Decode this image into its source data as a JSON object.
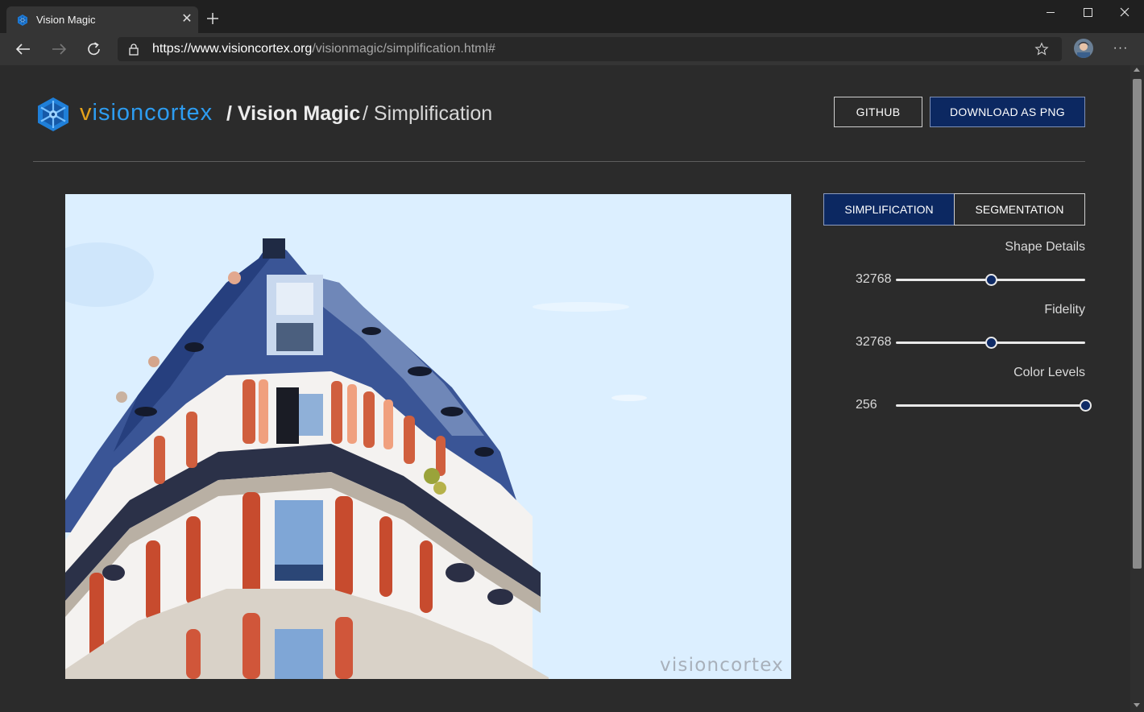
{
  "browser": {
    "tab_title": "Vision Magic",
    "url_scheme": "https://",
    "url_host": "www.visioncortex.org",
    "url_path": "/visionmagic/simplification.html#"
  },
  "header": {
    "brand_v": "v",
    "brand_rest": "isioncortex",
    "crumb_1": "/ Vision Magic",
    "crumb_2": "/ Simplification",
    "github_label": "GITHUB",
    "download_label": "DOWNLOAD AS PNG"
  },
  "artwork": {
    "watermark": "visioncortex"
  },
  "controls": {
    "tabs": [
      {
        "label": "SIMPLIFICATION",
        "active": true
      },
      {
        "label": "SEGMENTATION",
        "active": false
      }
    ],
    "sliders": [
      {
        "label": "Shape Details",
        "value": "32768",
        "level": 0.5
      },
      {
        "label": "Fidelity",
        "value": "32768",
        "level": 0.5
      },
      {
        "label": "Color Levels",
        "value": "256",
        "level": 1.0
      }
    ]
  },
  "colors": {
    "accent_navy": "#0c2861",
    "brand_blue": "#2d9cf0",
    "brand_orange": "#e4a11b",
    "sky": "#dcefff"
  }
}
